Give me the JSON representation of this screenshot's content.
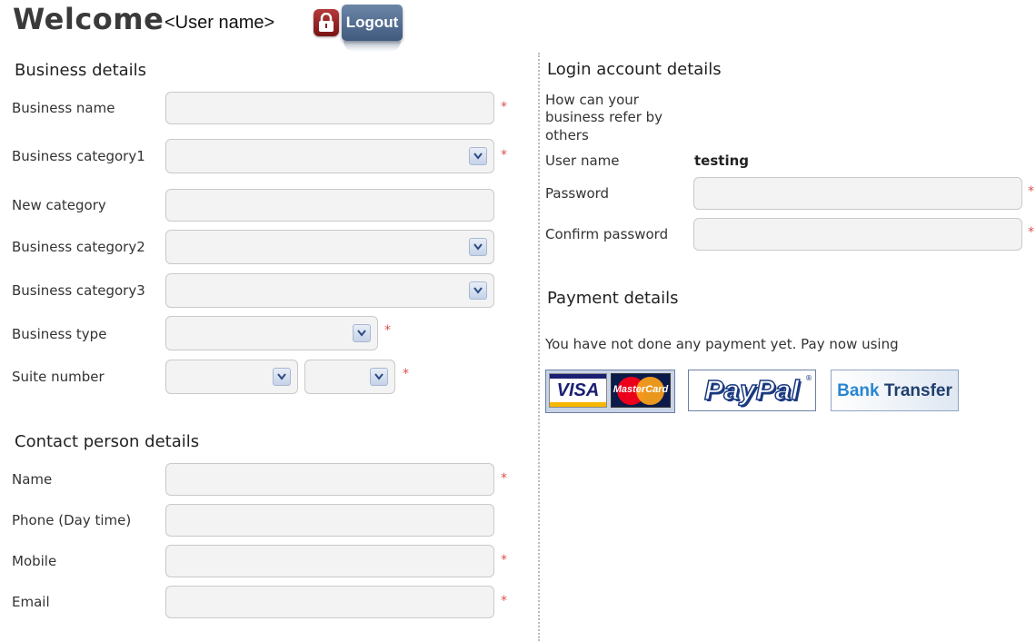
{
  "header": {
    "welcome": "Welcome",
    "user_placeholder": "<User name>",
    "logout_label": "Logout"
  },
  "business": {
    "title": "Business details",
    "fields": {
      "business_name": "Business name",
      "category1": "Business category1",
      "new_category": "New category",
      "category2": "Business category2",
      "category3": "Business category3",
      "business_type": "Business type",
      "suite_number": "Suite number"
    }
  },
  "contact": {
    "title": "Contact person details",
    "fields": {
      "name": "Name",
      "phone": "Phone (Day time)",
      "mobile": "Mobile",
      "email": "Email"
    }
  },
  "login": {
    "title": "Login account details",
    "refer_line1": "How can your",
    "refer_line2": "business refer by",
    "refer_line3": "others",
    "username_label": "User name",
    "username_value": "testing",
    "password_label": "Password",
    "confirm_label": "Confirm password"
  },
  "payment": {
    "title": "Payment details",
    "message": "You have not done any payment yet. Pay now using",
    "visa": "VISA",
    "mastercard": "MasterCard",
    "paypal": "PayPal",
    "paypal_reg": "®",
    "bank_word1": "Bank",
    "bank_word2": "Transfer"
  },
  "required_mark": "*",
  "colors": {
    "required": "#d9534f",
    "logout_bg": "#4f6a8f",
    "field_bg": "#f3f3f3"
  }
}
